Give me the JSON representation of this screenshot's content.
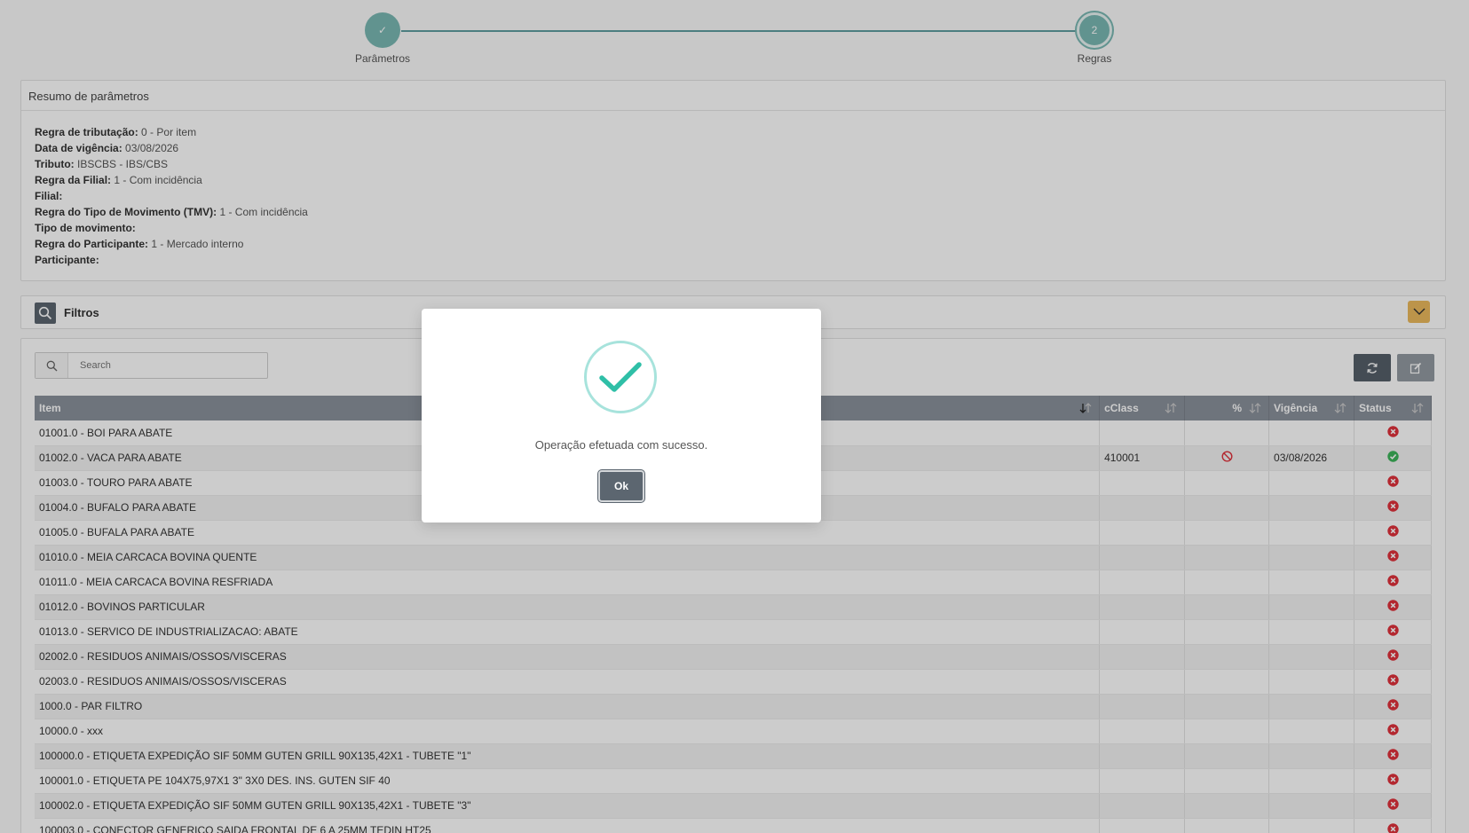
{
  "stepper": {
    "steps": [
      {
        "label": "Parâmetros",
        "number": "✓"
      },
      {
        "label": "Regras",
        "number": "2"
      }
    ]
  },
  "summary": {
    "title": "Resumo de parâmetros",
    "rows": [
      {
        "label": "Regra de tributação:",
        "value": "0 - Por item"
      },
      {
        "label": "Data de vigência:",
        "value": "03/08/2026"
      },
      {
        "label": "Tributo:",
        "value": "IBSCBS - IBS/CBS"
      },
      {
        "label": "Regra da Filial:",
        "value": "1 - Com incidência"
      },
      {
        "label": "Filial:",
        "value": ""
      },
      {
        "label": "Regra do Tipo de Movimento (TMV):",
        "value": "1 - Com incidência"
      },
      {
        "label": "Tipo de movimento:",
        "value": ""
      },
      {
        "label": "Regra do Participante:",
        "value": "1 - Mercado interno"
      },
      {
        "label": "Participante:",
        "value": ""
      }
    ]
  },
  "filters": {
    "title": "Filtros"
  },
  "search": {
    "placeholder": "Search",
    "value": ""
  },
  "table": {
    "headers": {
      "item": "Item",
      "cclass": "cClass",
      "pct": "%",
      "vigencia": "Vigência",
      "status": "Status"
    },
    "rows": [
      {
        "item": "01001.0 - BOI PARA ABATE",
        "cclass": "",
        "pct": "",
        "vigencia": "",
        "status": "error"
      },
      {
        "item": "01002.0 - VACA PARA ABATE",
        "cclass": "410001",
        "pct": "blocked",
        "vigencia": "03/08/2026",
        "status": "ok"
      },
      {
        "item": "01003.0 - TOURO PARA ABATE",
        "cclass": "",
        "pct": "",
        "vigencia": "",
        "status": "error"
      },
      {
        "item": "01004.0 - BUFALO PARA ABATE",
        "cclass": "",
        "pct": "",
        "vigencia": "",
        "status": "error"
      },
      {
        "item": "01005.0 - BUFALA PARA ABATE",
        "cclass": "",
        "pct": "",
        "vigencia": "",
        "status": "error"
      },
      {
        "item": "01010.0 - MEIA CARCACA BOVINA QUENTE",
        "cclass": "",
        "pct": "",
        "vigencia": "",
        "status": "error"
      },
      {
        "item": "01011.0 - MEIA CARCACA BOVINA RESFRIADA",
        "cclass": "",
        "pct": "",
        "vigencia": "",
        "status": "error"
      },
      {
        "item": "01012.0 - BOVINOS PARTICULAR",
        "cclass": "",
        "pct": "",
        "vigencia": "",
        "status": "error"
      },
      {
        "item": "01013.0 - SERVICO DE INDUSTRIALIZACAO: ABATE",
        "cclass": "",
        "pct": "",
        "vigencia": "",
        "status": "error"
      },
      {
        "item": "02002.0 - RESIDUOS ANIMAIS/OSSOS/VISCERAS",
        "cclass": "",
        "pct": "",
        "vigencia": "",
        "status": "error"
      },
      {
        "item": "02003.0 - RESIDUOS ANIMAIS/OSSOS/VISCERAS",
        "cclass": "",
        "pct": "",
        "vigencia": "",
        "status": "error"
      },
      {
        "item": "1000.0 - PAR FILTRO",
        "cclass": "",
        "pct": "",
        "vigencia": "",
        "status": "error"
      },
      {
        "item": "10000.0 - xxx",
        "cclass": "",
        "pct": "",
        "vigencia": "",
        "status": "error"
      },
      {
        "item": "100000.0 - ETIQUETA EXPEDIÇÃO SIF 50MM GUTEN GRILL 90X135,42X1 - TUBETE \"1\"",
        "cclass": "",
        "pct": "",
        "vigencia": "",
        "status": "error"
      },
      {
        "item": "100001.0 - ETIQUETA PE 104X75,97X1 3\" 3X0 DES. INS. GUTEN SIF 40",
        "cclass": "",
        "pct": "",
        "vigencia": "",
        "status": "error"
      },
      {
        "item": "100002.0 - ETIQUETA EXPEDIÇÃO SIF 50MM GUTEN GRILL 90X135,42X1 - TUBETE \"3\"",
        "cclass": "",
        "pct": "",
        "vigencia": "",
        "status": "error"
      },
      {
        "item": "100003.0 - CONECTOR GENERICO SAIDA FRONTAL DE 6 A 25MM TEDIN HT25",
        "cclass": "",
        "pct": "",
        "vigencia": "",
        "status": "error"
      }
    ]
  },
  "modal": {
    "message": "Operação efetuada com sucesso.",
    "ok_label": "Ok"
  },
  "colors": {
    "accent": "#7ab8b3",
    "success": "#2fbfa7",
    "error": "#e0313b",
    "ok": "#3cb45a"
  }
}
